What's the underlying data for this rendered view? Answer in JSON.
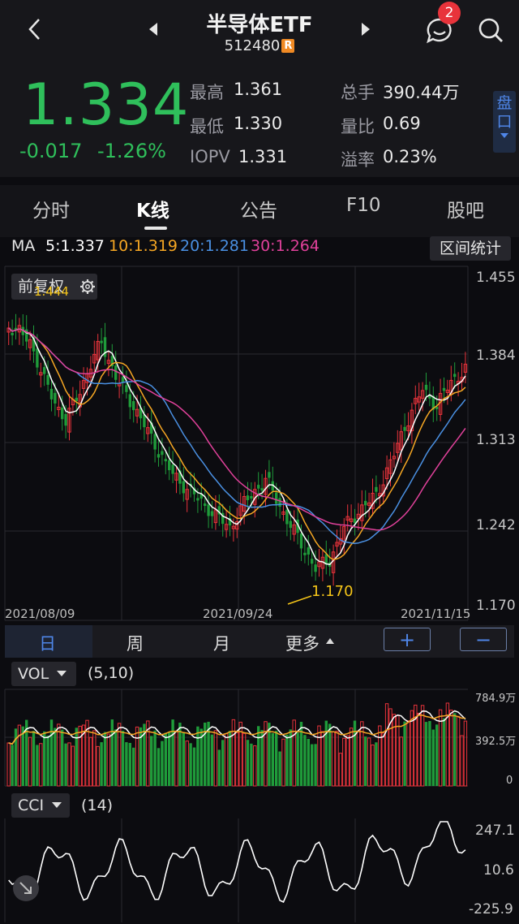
{
  "header": {
    "title": "半导体ETF",
    "code": "512480",
    "code_badge": "R",
    "message_count": "2"
  },
  "quote": {
    "price": "1.334",
    "change": "-0.017",
    "change_pct": "-1.26%",
    "stats": [
      {
        "label": "最高",
        "value": "1.361"
      },
      {
        "label": "最低",
        "value": "1.330"
      },
      {
        "label": "IOPV",
        "value": "1.331"
      },
      {
        "label": "总手",
        "value": "390.44万"
      },
      {
        "label": "量比",
        "value": "0.69"
      },
      {
        "label": "溢率",
        "value": "0.23%"
      }
    ],
    "pankou_label": "盘口"
  },
  "tabs": [
    "分时",
    "K线",
    "公告",
    "F10",
    "股吧"
  ],
  "active_tab": "K线",
  "ma": {
    "label": "MA",
    "items": [
      "5:1.337",
      "10:1.319",
      "20:1.281",
      "30:1.264"
    ],
    "range_button": "区间统计"
  },
  "chart": {
    "adjust_button": "前复权",
    "y_ticks": [
      "1.455",
      "1.384",
      "1.313",
      "1.242",
      "1.170"
    ],
    "high_mark": "1.444",
    "low_mark": "1.170",
    "dates": [
      "2021/08/09",
      "2021/09/24",
      "2021/11/15"
    ]
  },
  "periods": [
    "日",
    "周",
    "月",
    "更多"
  ],
  "zoom": {
    "plus": "+",
    "minus": "−"
  },
  "vol": {
    "name": "VOL",
    "params": "(5,10)",
    "ticks": [
      "784.9万",
      "392.5万",
      "0"
    ]
  },
  "cci": {
    "name": "CCI",
    "params": "(14)",
    "ticks": [
      "247.1",
      "10.6",
      "-225.9"
    ]
  },
  "colors": {
    "up": "#e8333b",
    "down": "#1f9b3a",
    "ma5": "#ffffff",
    "ma10": "#f5a623",
    "ma20": "#4a90e2",
    "ma30": "#e0419a",
    "accent": "#4f86e8"
  }
}
